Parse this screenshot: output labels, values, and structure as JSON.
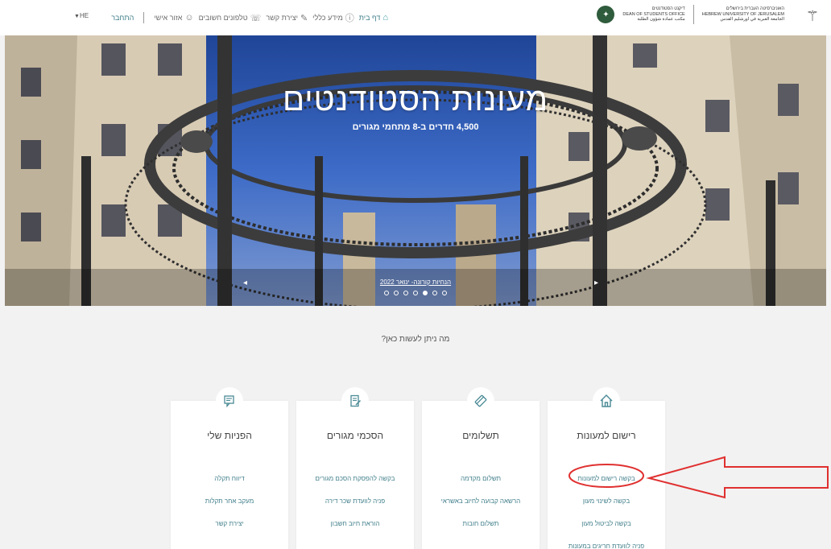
{
  "header": {
    "lang": "HE",
    "nav": [
      {
        "label": "דף בית",
        "icon": "home-icon"
      },
      {
        "label": "מידע כללי",
        "icon": "info-icon"
      },
      {
        "label": "יצירת קשר",
        "icon": "contact-icon"
      },
      {
        "label": "טלפונים חשובים",
        "icon": "phone-book-icon"
      },
      {
        "label": "אזור אישי",
        "icon": "personal-area-icon"
      },
      {
        "label": "התחבר",
        "icon": ""
      }
    ],
    "dean_office": {
      "line1": "דיקנט הסטודנטים",
      "line2": "DEAN OF STUDENTS OFFICE",
      "line3": "مكتب عمادة شؤون الطلبة"
    },
    "university": {
      "line1": "האוניברסיטה העברית בירושלים",
      "line2": "HEBREW UNIVERSITY OF JERUSALEM",
      "line3": "الجامعة العبرية في اورشليم القدس"
    }
  },
  "hero": {
    "title": "מעונות הסטודנטים",
    "subtitle": "4,500 חדרים ב-8 מתחמי מגורים",
    "slide_caption": "הנחיות קורונה- ינואר 2022",
    "active_slide": 5,
    "slide_count": 7
  },
  "main": {
    "question": "מה ניתן לעשות כאן?",
    "cards": [
      {
        "title": "רישום למעונות",
        "icon": "house-icon",
        "links": [
          "בקשה רישום למעונות",
          "בקשה לשינוי מעון",
          "בקשה לביטול מעון",
          "פניה לוועדת חריגים במעונות"
        ]
      },
      {
        "title": "תשלומים",
        "icon": "credit-card-icon",
        "links": [
          "תשלום מקדמה",
          "הרשאה קבועה לחיוב באשראי",
          "תשלום חובות"
        ]
      },
      {
        "title": "הסכמי מגורים",
        "icon": "contract-icon",
        "links": [
          "בקשה להפסקת הסכם מגורים",
          "פניה לוועדת שכר דירה",
          "הוראת חיוב חשבון"
        ]
      },
      {
        "title": "הפניות שלי",
        "icon": "chat-icon",
        "links": [
          "דיווח תקלה",
          "מעקב אחר תקלות",
          "יצירת קשר"
        ]
      }
    ]
  },
  "colors": {
    "accent": "#3f7e8a",
    "annotation": "#e03030"
  }
}
